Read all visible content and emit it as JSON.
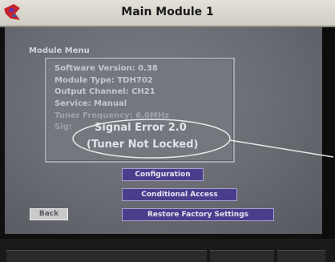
{
  "header": {
    "title": "Main Module 1"
  },
  "module_menu": {
    "heading": "Module Menu",
    "info_lines": [
      "Software Version:  0.38",
      "Module Type:  TDH702",
      "Output Channel:  CH21",
      "Service:  Manual",
      "Tuner Frequency:  6.0MHz",
      "Sig:"
    ],
    "signal_error": "Signal Error 2.0",
    "signal_error_detail": "(Tuner Not Locked)"
  },
  "buttons": {
    "configuration": "Configuration",
    "conditional_access": "Conditional Access",
    "restore_factory": "Restore Factory Settings",
    "back": "Back"
  },
  "colors": {
    "button_fill": "#4a3e8c",
    "panel_fill": "#74777d",
    "screen_bg": "#686b71"
  },
  "icons": {
    "logo": "logo-icon"
  }
}
